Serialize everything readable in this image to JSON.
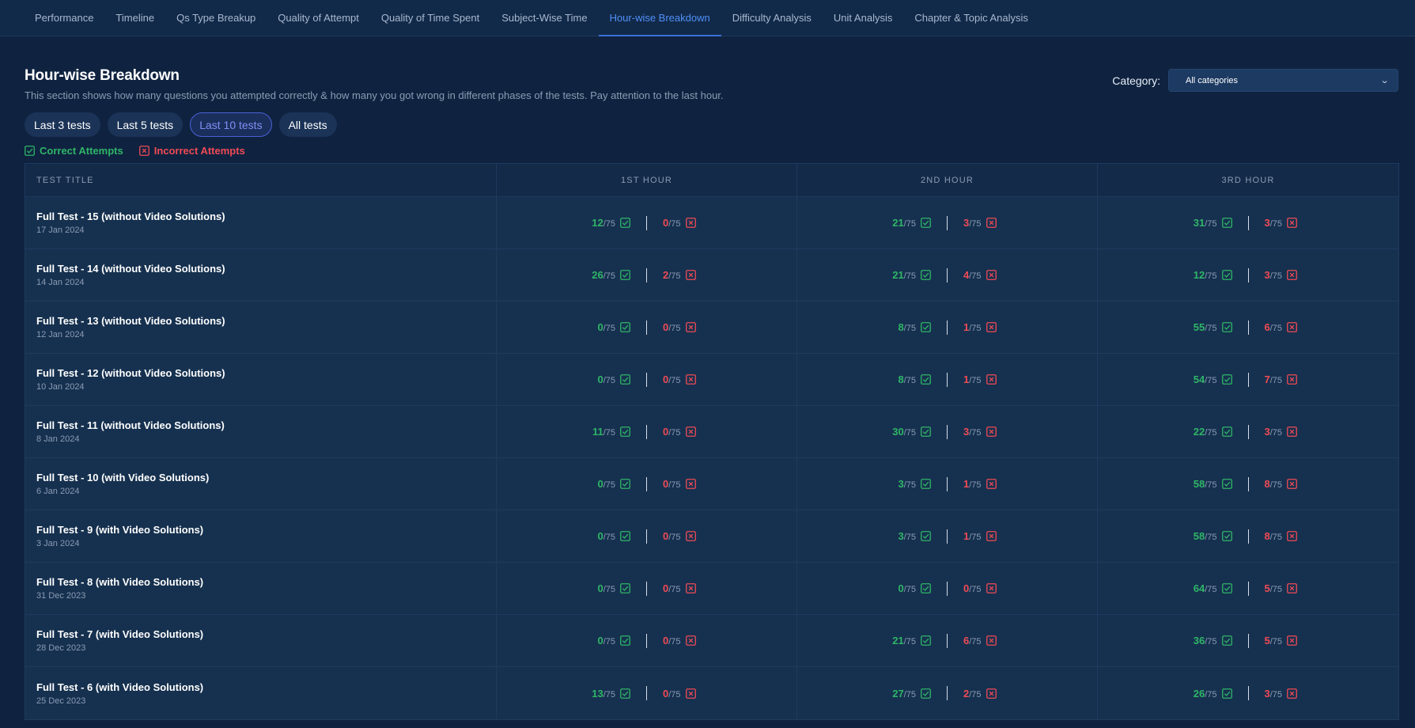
{
  "nav": {
    "tabs": [
      {
        "label": "Performance",
        "active": false
      },
      {
        "label": "Timeline",
        "active": false
      },
      {
        "label": "Qs Type Breakup",
        "active": false
      },
      {
        "label": "Quality of Attempt",
        "active": false
      },
      {
        "label": "Quality of Time Spent",
        "active": false
      },
      {
        "label": "Subject-Wise Time",
        "active": false
      },
      {
        "label": "Hour-wise Breakdown",
        "active": true
      },
      {
        "label": "Difficulty Analysis",
        "active": false
      },
      {
        "label": "Unit Analysis",
        "active": false
      },
      {
        "label": "Chapter & Topic Analysis",
        "active": false
      }
    ]
  },
  "header": {
    "title": "Hour-wise Breakdown",
    "description": "This section shows how many questions you attempted correctly & how many you got wrong in different phases of the tests. Pay attention to the last hour.",
    "category_label": "Category:",
    "category_value": "All categories"
  },
  "filters": [
    {
      "label": "Last 3 tests",
      "active": false
    },
    {
      "label": "Last 5 tests",
      "active": false
    },
    {
      "label": "Last 10 tests",
      "active": true
    },
    {
      "label": "All tests",
      "active": false
    }
  ],
  "legend": {
    "correct": "Correct Attempts",
    "incorrect": "Incorrect Attempts"
  },
  "colors": {
    "correct": "#2fb567",
    "incorrect": "#f04a55",
    "accent": "#4f8ff7"
  },
  "table": {
    "headers": [
      "TEST TITLE",
      "1ST HOUR",
      "2ND HOUR",
      "3RD HOUR"
    ],
    "total_suffix": "/75",
    "rows": [
      {
        "title": "Full Test - 15 (without Video Solutions)",
        "date": "17 Jan 2024",
        "hours": [
          {
            "c": "12",
            "w": "0"
          },
          {
            "c": "21",
            "w": "3"
          },
          {
            "c": "31",
            "w": "3"
          }
        ]
      },
      {
        "title": "Full Test - 14 (without Video Solutions)",
        "date": "14 Jan 2024",
        "hours": [
          {
            "c": "26",
            "w": "2"
          },
          {
            "c": "21",
            "w": "4"
          },
          {
            "c": "12",
            "w": "3"
          }
        ]
      },
      {
        "title": "Full Test - 13 (without Video Solutions)",
        "date": "12 Jan 2024",
        "hours": [
          {
            "c": "0",
            "w": "0"
          },
          {
            "c": "8",
            "w": "1"
          },
          {
            "c": "55",
            "w": "6"
          }
        ]
      },
      {
        "title": "Full Test - 12 (without Video Solutions)",
        "date": "10 Jan 2024",
        "hours": [
          {
            "c": "0",
            "w": "0"
          },
          {
            "c": "8",
            "w": "1"
          },
          {
            "c": "54",
            "w": "7"
          }
        ]
      },
      {
        "title": "Full Test - 11 (without Video Solutions)",
        "date": "8 Jan 2024",
        "hours": [
          {
            "c": "11",
            "w": "0"
          },
          {
            "c": "30",
            "w": "3"
          },
          {
            "c": "22",
            "w": "3"
          }
        ]
      },
      {
        "title": "Full Test - 10 (with Video Solutions)",
        "date": "6 Jan 2024",
        "hours": [
          {
            "c": "0",
            "w": "0"
          },
          {
            "c": "3",
            "w": "1"
          },
          {
            "c": "58",
            "w": "8"
          }
        ]
      },
      {
        "title": "Full Test - 9 (with Video Solutions)",
        "date": "3 Jan 2024",
        "hours": [
          {
            "c": "0",
            "w": "0"
          },
          {
            "c": "3",
            "w": "1"
          },
          {
            "c": "58",
            "w": "8"
          }
        ]
      },
      {
        "title": "Full Test - 8 (with Video Solutions)",
        "date": "31 Dec 2023",
        "hours": [
          {
            "c": "0",
            "w": "0"
          },
          {
            "c": "0",
            "w": "0"
          },
          {
            "c": "64",
            "w": "5"
          }
        ]
      },
      {
        "title": "Full Test - 7 (with Video Solutions)",
        "date": "28 Dec 2023",
        "hours": [
          {
            "c": "0",
            "w": "0"
          },
          {
            "c": "21",
            "w": "6"
          },
          {
            "c": "36",
            "w": "5"
          }
        ]
      },
      {
        "title": "Full Test - 6 (with Video Solutions)",
        "date": "25 Dec 2023",
        "hours": [
          {
            "c": "13",
            "w": "0"
          },
          {
            "c": "27",
            "w": "2"
          },
          {
            "c": "26",
            "w": "3"
          }
        ]
      }
    ]
  }
}
